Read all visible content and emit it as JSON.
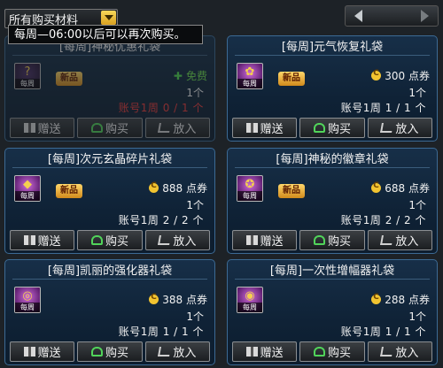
{
  "dropdown": {
    "label": "所有购买材料"
  },
  "tooltip": {
    "text": "每周—06:00以后可以再次购买。"
  },
  "labels": {
    "gift": "赠送",
    "buy": "购买",
    "cart": "放入",
    "new": "新品",
    "icon_badge": "每周"
  },
  "cards": [
    {
      "title": "[每周]神秘优惠礼袋",
      "new": true,
      "price": "免费",
      "qty": "1个",
      "limit": "账号1周 0 / 1 个",
      "faded": true
    },
    {
      "title": "[每周]元气恢复礼袋",
      "new": true,
      "price": "300 点券",
      "qty": "1个",
      "limit": "账号1周 1 / 1 个"
    },
    {
      "title": "[每周]次元玄晶碎片礼袋",
      "new": true,
      "price": "888 点券",
      "qty": "1个",
      "limit": "账号1周 2 / 2 个"
    },
    {
      "title": "[每周]神秘的徽章礼袋",
      "new": true,
      "price": "688 点券",
      "qty": "1个",
      "limit": "账号1周 2 / 2 个"
    },
    {
      "title": "[每周]凯丽的强化器礼袋",
      "new": false,
      "price": "388 点券",
      "qty": "1个",
      "limit": "账号1周 1 / 1 个"
    },
    {
      "title": "[每周]一次性增幅器礼袋",
      "new": false,
      "price": "288 点券",
      "qty": "1个",
      "limit": "账号1周 1 / 1 个"
    }
  ],
  "colors": {
    "accent_gold": "#f2c430",
    "limit_red": "#ee3a3a",
    "free_green": "#6fe04f",
    "panel_blue": "#172f48"
  }
}
